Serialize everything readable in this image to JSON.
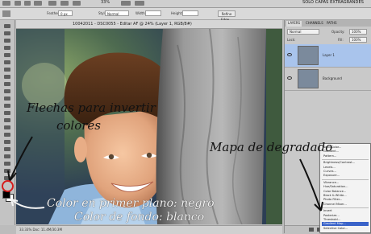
{
  "top_bar": {
    "zoom": "33%",
    "workspace": "SÓLO CAPAS EXTRAGRANDES"
  },
  "options_bar": {
    "feather_label": "Feather:",
    "feather_value": "0 px",
    "style_label": "Style:",
    "style_value": "Normal",
    "width_label": "Width:",
    "height_label": "Height:",
    "refine_label": "Refine Edge..."
  },
  "document": {
    "tab_title": "10042011 - DSC0055 - Editar AF @ 24% (Layer 1, RGB/8#)",
    "status": "33.33%   Doc: 11.4M/30.3M"
  },
  "layers_panel": {
    "tabs": [
      "LAYERS",
      "CHANNELS",
      "PATHS"
    ],
    "blend_mode": "Normal",
    "opacity_label": "Opacity:",
    "opacity_value": "100%",
    "lock_label": "Lock:",
    "fill_label": "Fill:",
    "fill_value": "100%",
    "layers": [
      {
        "name": "Layer 1",
        "selected": true
      },
      {
        "name": "Background",
        "selected": false
      }
    ]
  },
  "adjustment_menu": {
    "items": [
      "Solid Color...",
      "Gradient...",
      "Pattern...",
      "Brightness/Contrast...",
      "Levels...",
      "Curves...",
      "Exposure...",
      "Vibrance...",
      "Hue/Saturation...",
      "Color Balance...",
      "Black & White...",
      "Photo Filter...",
      "Channel Mixer...",
      "Invert",
      "Posterize...",
      "Threshold...",
      "Gradient Map...",
      "Selective Color..."
    ],
    "highlighted": "Gradient Map..."
  },
  "annotations": {
    "swap_colors": [
      "Flechas para invertir",
      "colores"
    ],
    "gradient_map": "Mapa de degradado",
    "foreground": "Color en primer plano: negro",
    "background": "Color de fondo: blanco"
  },
  "colors": {
    "menu_highlight": "#3a63c9",
    "layer_selected": "#a9c4ec"
  }
}
